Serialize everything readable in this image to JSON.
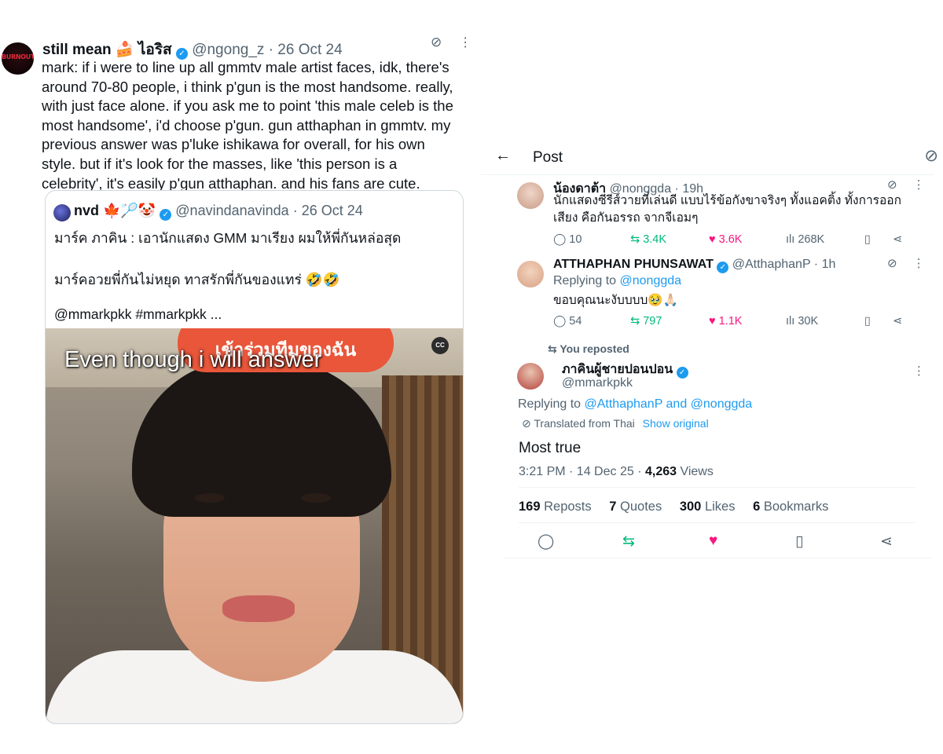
{
  "left_tweet": {
    "avatar_text": "BURNOUT",
    "author_name": "still mean 🍰 ไอริส",
    "handle": "@ngong_z",
    "date": "26 Oct 24",
    "body_lines": [
      "mark: if i were to line up all gmmtv male artist faces, idk, there's",
      "around 70-80 people, i think p'gun is the most handsome. really,",
      "with just face alone. if you ask me to point 'this male celeb is the",
      "most handsome', i'd choose p'gun. gun atthaphan in gmmtv. my",
      "previous answer was p'luke ishikawa for overall, for his own",
      "style. but if it's look for the masses, like 'this person is a",
      "celebrity', it's easily p'gun atthaphan. and his fans are cute."
    ]
  },
  "quoted_tweet": {
    "author_name": "nvd 🍁🏸🤡",
    "handle": "@navindanavinda",
    "date": "26 Oct 24",
    "line1": "มาร์ค ภาคิน : เอานักแสดง GMM มาเรียง ผมให้พี่กันหล่อสุด",
    "line2": "มาร์คอวยพี่กันไม่หยุด ทาสรักพี่กันของแทร่ 🤣🤣",
    "line3": "@mmarkpkk #mmarkpkk ...",
    "video_caption": "Even though i will answer",
    "video_sticker": "เข้าร่วมทีมของฉัน",
    "cc_label": "CC"
  },
  "right_post": {
    "header_title": "Post",
    "reply1": {
      "author_name": "น้องดาต้า",
      "handle": "@nonggda",
      "time": "19h",
      "text_line1": "นักแสดงซีรีส์วายที่เล่นดี แบบไร้ข้อกังขาจริงๆ ทั้งแอคติ้ง ทั้งการออก",
      "text_line2": "เสียง คือกันอรรถ จากจีเอมๆ",
      "replies": "10",
      "reposts": "3.4K",
      "likes": "3.6K",
      "views": "268K"
    },
    "reply2": {
      "author_name": "ATTHAPHAN PHUNSAWAT",
      "handle": "@AtthaphanP",
      "time": "1h",
      "replying_label": "Replying to",
      "replying_to": "@nonggda",
      "text": "ขอบคุณนะงับบบบ🥹🙏🏻",
      "replies": "54",
      "reposts": "797",
      "likes": "1.1K",
      "views": "30K"
    },
    "main": {
      "reposted_label": "You reposted",
      "author_name": "ภาคินผู้ชายปอนปอน",
      "handle": "@mmarkpkk",
      "replying_label": "Replying to",
      "replying_to": "@AtthaphanP and @nonggda",
      "translated_label": "Translated from Thai",
      "show_original": "Show original",
      "text": "Most true",
      "time_date": "3:21 PM · 14 Dec 25 · ",
      "views_count": "4,263",
      "views_label": " Views",
      "reposts_count": "169",
      "reposts_label": " Reposts",
      "quotes_count": "7",
      "quotes_label": " Quotes",
      "likes_count": "300",
      "likes_label": " Likes",
      "bookmarks_count": "6",
      "bookmarks_label": " Bookmarks"
    }
  },
  "colors": {
    "accent_blue": "#1d9bf0",
    "repost_green": "#00ba7c",
    "like_pink": "#f91880",
    "muted_gray": "#536471"
  }
}
